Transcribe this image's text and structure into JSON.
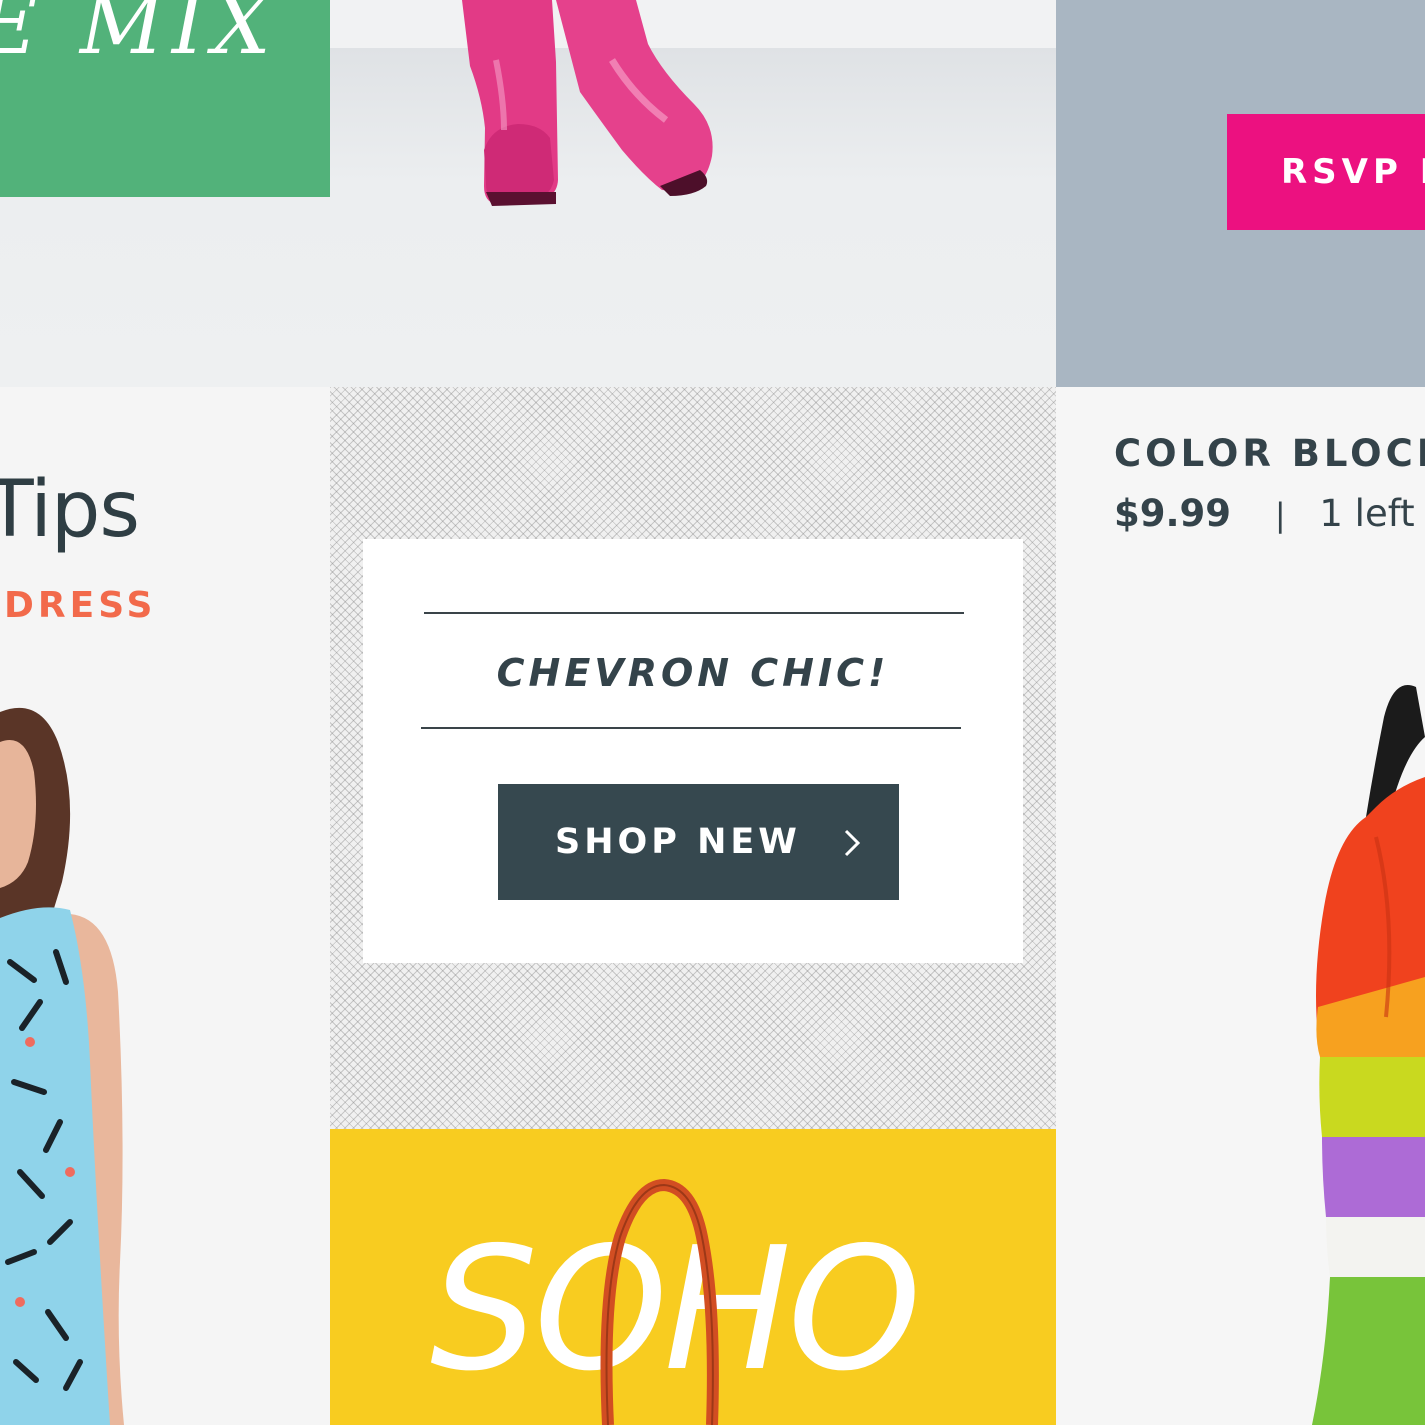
{
  "promo_mix": {
    "text": "E MIX"
  },
  "rsvp": {
    "label": "RSVP N"
  },
  "tips": {
    "title": "Tips",
    "subtitle": "DRESS"
  },
  "chevron_card": {
    "title": "CHEVRON CHIC!",
    "button_label": "SHOP NEW"
  },
  "soho": {
    "text": "SOHO"
  },
  "product": {
    "name": "COLOR BLOCK",
    "price": "$9.99",
    "separator": "|",
    "stock": "1 left"
  },
  "colors": {
    "green_block": "#52b27a",
    "rsvp_pink": "#ec1180",
    "charcoal": "#36484f",
    "soho_yellow": "#f8cc20",
    "coral": "#f26a4b"
  },
  "icons": {
    "shop_chevron": "chevron-right-icon"
  }
}
